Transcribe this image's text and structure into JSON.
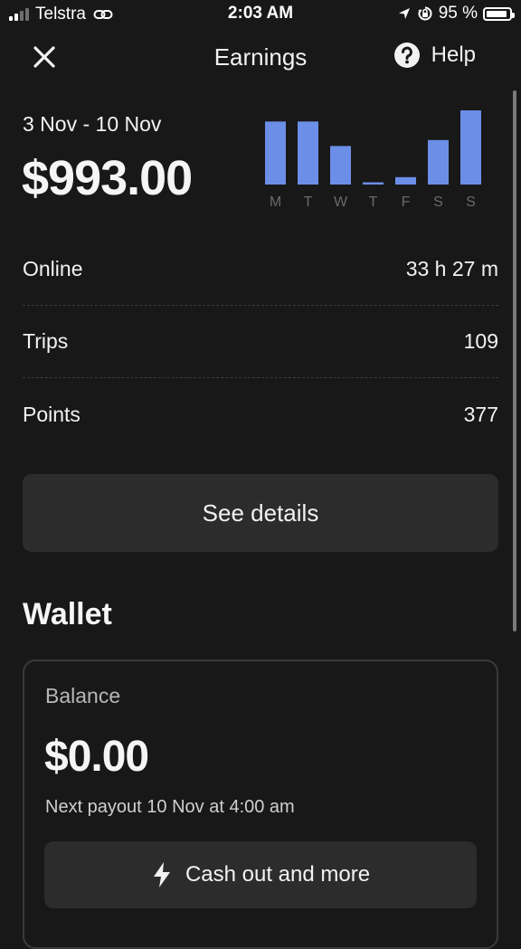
{
  "status_bar": {
    "carrier": "Telstra",
    "time": "2:03 AM",
    "battery": "95 %",
    "battery_level": 0.95,
    "signal_bars_filled": 2,
    "icons": [
      "signal-icon",
      "link-icon",
      "location-arrow-icon",
      "orientation-lock-icon",
      "battery-icon"
    ]
  },
  "header": {
    "title": "Earnings",
    "help_label": "Help",
    "close_icon": "close-icon",
    "help_icon": "question-circle-icon"
  },
  "summary": {
    "date_range": "3 Nov - 10 Nov",
    "amount": "$993.00"
  },
  "chart_data": {
    "type": "bar",
    "categories": [
      "M",
      "T",
      "W",
      "T",
      "F",
      "S",
      "S"
    ],
    "values": [
      0.85,
      0.85,
      0.52,
      0.03,
      0.1,
      0.6,
      1.0
    ],
    "ylim": [
      0,
      1
    ],
    "bar_color": "#6b8ee6",
    "grid": false
  },
  "stats": [
    {
      "label": "Online",
      "value": "33 h 27 m"
    },
    {
      "label": "Trips",
      "value": "109"
    },
    {
      "label": "Points",
      "value": "377"
    }
  ],
  "details_button": "See details",
  "wallet": {
    "title": "Wallet",
    "balance_label": "Balance",
    "balance": "$0.00",
    "next_payout": "Next payout 10 Nov at 4:00 am",
    "cashout_label": "Cash out and more",
    "cashout_icon": "lightning-bolt-icon"
  },
  "colors": {
    "background": "#181818",
    "surface": "#2c2c2c",
    "accent": "#6b8ee6"
  }
}
